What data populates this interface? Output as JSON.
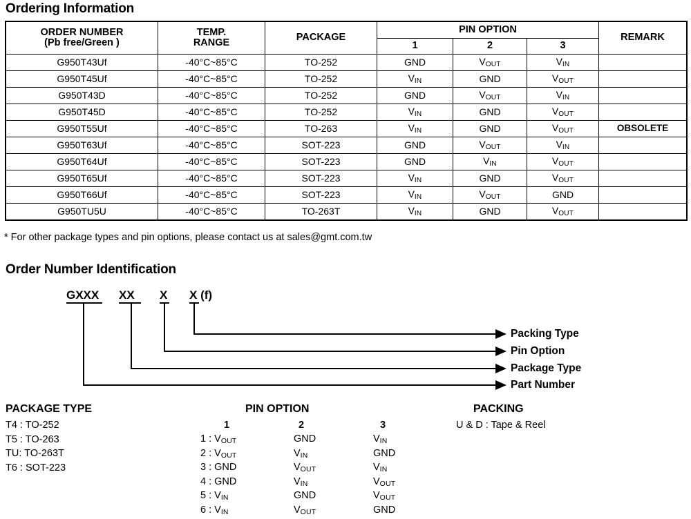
{
  "ordering": {
    "title": "Ordering Information",
    "headers": {
      "order_number_line1": "ORDER NUMBER",
      "order_number_line2": "(Pb free/Green )",
      "temp_line1": "TEMP.",
      "temp_line2": "RANGE",
      "package": "PACKAGE",
      "pin_option": "PIN OPTION",
      "pin1": "1",
      "pin2": "2",
      "pin3": "3",
      "remark": "REMARK"
    },
    "rows": [
      {
        "order_number": "G950T43Uf",
        "temp_range": "-40°C~85°C",
        "package": "TO-252",
        "pin1": "GND",
        "pin1_sub": "",
        "pin2": "V",
        "pin2_sub": "OUT",
        "pin3": "V",
        "pin3_sub": "IN",
        "remark": ""
      },
      {
        "order_number": "G950T45Uf",
        "temp_range": "-40°C~85°C",
        "package": "TO-252",
        "pin1": "V",
        "pin1_sub": "IN",
        "pin2": "GND",
        "pin2_sub": "",
        "pin3": "V",
        "pin3_sub": "OUT",
        "remark": ""
      },
      {
        "order_number": "G950T43D",
        "temp_range": "-40°C~85°C",
        "package": "TO-252",
        "pin1": "GND",
        "pin1_sub": "",
        "pin2": "V",
        "pin2_sub": "OUT",
        "pin3": "V",
        "pin3_sub": "IN",
        "remark": ""
      },
      {
        "order_number": "G950T45D",
        "temp_range": "-40°C~85°C",
        "package": "TO-252",
        "pin1": "V",
        "pin1_sub": "IN",
        "pin2": "GND",
        "pin2_sub": "",
        "pin3": "V",
        "pin3_sub": "OUT",
        "remark": ""
      },
      {
        "order_number": "G950T55Uf",
        "temp_range": "-40°C~85°C",
        "package": "TO-263",
        "pin1": "V",
        "pin1_sub": "IN",
        "pin2": "GND",
        "pin2_sub": "",
        "pin3": "V",
        "pin3_sub": "OUT",
        "remark": "OBSOLETE"
      },
      {
        "order_number": "G950T63Uf",
        "temp_range": "-40°C~85°C",
        "package": "SOT-223",
        "pin1": "GND",
        "pin1_sub": "",
        "pin2": "V",
        "pin2_sub": "OUT",
        "pin3": "V",
        "pin3_sub": "IN",
        "remark": ""
      },
      {
        "order_number": "G950T64Uf",
        "temp_range": "-40°C~85°C",
        "package": "SOT-223",
        "pin1": "GND",
        "pin1_sub": "",
        "pin2": "V",
        "pin2_sub": "IN",
        "pin3": "V",
        "pin3_sub": "OUT",
        "remark": ""
      },
      {
        "order_number": "G950T65Uf",
        "temp_range": "-40°C~85°C",
        "package": "SOT-223",
        "pin1": "V",
        "pin1_sub": "IN",
        "pin2": "GND",
        "pin2_sub": "",
        "pin3": "V",
        "pin3_sub": "OUT",
        "remark": ""
      },
      {
        "order_number": "G950T66Uf",
        "temp_range": "-40°C~85°C",
        "package": "SOT-223",
        "pin1": "V",
        "pin1_sub": "IN",
        "pin2": "V",
        "pin2_sub": "OUT",
        "pin3": "GND",
        "pin3_sub": "",
        "remark": ""
      },
      {
        "order_number": "G950TU5U",
        "temp_range": "-40°C~85°C",
        "package": "TO-263T",
        "pin1": "V",
        "pin1_sub": "IN",
        "pin2": "GND",
        "pin2_sub": "",
        "pin3": "V",
        "pin3_sub": "OUT",
        "remark": ""
      }
    ],
    "footnote": "* For other package types and pin options, please contact us at sales@gmt.com.tw"
  },
  "identification": {
    "title": "Order Number Identification",
    "code_parts": [
      {
        "text": "GXXX",
        "suffix": ""
      },
      {
        "text": "XX",
        "suffix": ""
      },
      {
        "text": "X",
        "suffix": ""
      },
      {
        "text": "X",
        "suffix": " (f)"
      }
    ],
    "callouts": [
      {
        "label": "Packing Type"
      },
      {
        "label": "Pin Option"
      },
      {
        "label": "Package Type"
      },
      {
        "label": "Part Number"
      }
    ]
  },
  "legend": {
    "package_type": {
      "heading": "PACKAGE TYPE",
      "items": [
        "T4 : TO-252",
        "T5 : TO-263",
        "TU: TO-263T",
        "T6 : SOT-223"
      ]
    },
    "pin_option": {
      "heading": "PIN OPTION",
      "col1": "1",
      "col2": "2",
      "col3": "3",
      "rows": [
        {
          "label": "1 : ",
          "c1": "V",
          "c1_sub": "OUT",
          "c2": "GND",
          "c2_sub": "",
          "c3": "V",
          "c3_sub": "IN"
        },
        {
          "label": "2 : ",
          "c1": "V",
          "c1_sub": "OUT",
          "c2": "V",
          "c2_sub": "IN",
          "c3": "GND",
          "c3_sub": ""
        },
        {
          "label": "3 : ",
          "c1": "GND",
          "c1_sub": "",
          "c2": "V",
          "c2_sub": "OUT",
          "c3": "V",
          "c3_sub": "IN"
        },
        {
          "label": "4 : ",
          "c1": "GND",
          "c1_sub": "",
          "c2": "V",
          "c2_sub": "IN",
          "c3": "V",
          "c3_sub": "OUT"
        },
        {
          "label": "5 : ",
          "c1": "V",
          "c1_sub": "IN",
          "c2": "GND",
          "c2_sub": "",
          "c3": "V",
          "c3_sub": "OUT"
        },
        {
          "label": "6 : ",
          "c1": "V",
          "c1_sub": "IN",
          "c2": "V",
          "c2_sub": "OUT",
          "c3": "GND",
          "c3_sub": ""
        }
      ]
    },
    "packing": {
      "heading": "PACKING",
      "items": [
        "U & D : Tape & Reel"
      ]
    }
  }
}
